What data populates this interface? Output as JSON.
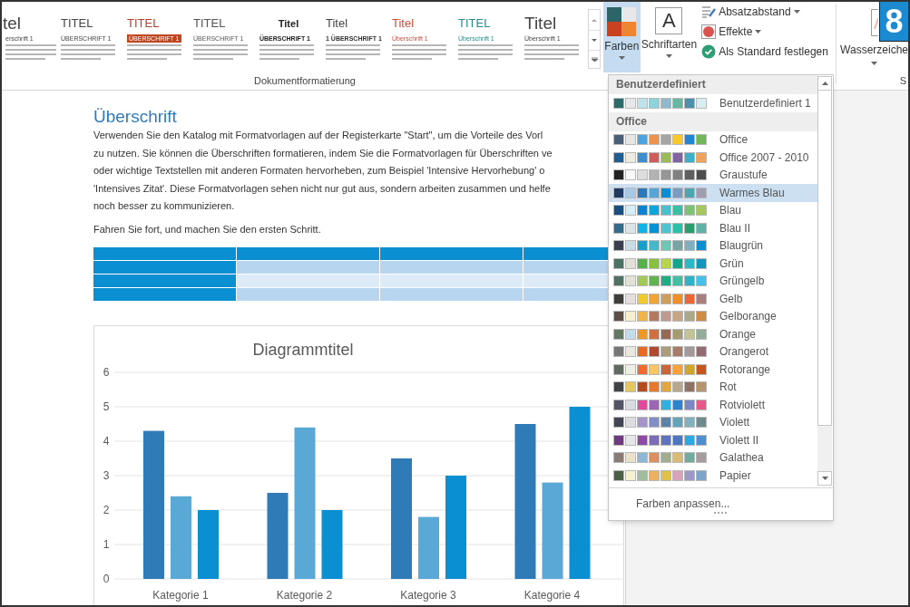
{
  "ribbon": {
    "gallery": [
      {
        "title": {
          "text": "tel",
          "color": "#444444"
        },
        "heading": {
          "text": "erschrift 1"
        },
        "kind": "large"
      },
      {
        "title": {
          "text": "TITEL",
          "color": "#444444"
        },
        "heading": {
          "text": "ÜBERSCHRIFT 1"
        },
        "kind": "plain"
      },
      {
        "title": {
          "text": "TITEL",
          "color": "#c0392b"
        },
        "heading": {
          "text": "ÜBERSCHRIFT 1",
          "color": "#c0461f"
        },
        "kind": "banner"
      },
      {
        "title": {
          "text": "TITEL",
          "color": "#555555"
        },
        "heading": {
          "text": "ÜBERSCHRIFT 1"
        },
        "kind": "plain"
      },
      {
        "title": {
          "text": "Titel",
          "color": "#222222"
        },
        "heading": {
          "text": "ÜBERSCHRIFT 1",
          "color": "#222222"
        },
        "kind": "bold"
      },
      {
        "title": {
          "text": "Titel",
          "color": "#444444"
        },
        "heading": {
          "text": "1 ÜBERSCHRIFT 1",
          "color": "#333333"
        },
        "kind": "bold-heading"
      },
      {
        "title": {
          "text": "Titel",
          "color": "#d04a3a"
        },
        "heading": {
          "text": "Überschrift 1"
        },
        "kind": "plain"
      },
      {
        "title": {
          "text": "TITEL",
          "color": "#2a8a8a"
        },
        "heading": {
          "text": "Überschrift 1"
        },
        "kind": "plain"
      },
      {
        "title": {
          "text": "Titel",
          "color": "#444444"
        },
        "heading": {
          "text": "Überschrift 1"
        },
        "kind": "large"
      }
    ],
    "gallery_label": "Dokumentformatierung",
    "colors_button": {
      "label": "Farben",
      "selected": true
    },
    "fonts_button": {
      "label": "Schriftarten",
      "icon_letter": "A"
    },
    "options": [
      {
        "label": "Absatzabstand",
        "kind": "spacing",
        "dropdown": true
      },
      {
        "label": "Effekte",
        "kind": "effects",
        "dropdown": true
      },
      {
        "label": "Als Standard festlegen",
        "kind": "default",
        "dropdown": false
      }
    ],
    "watermark_label": "Wasserzeiche",
    "next_group_label": "S",
    "badge": "8"
  },
  "document": {
    "heading": "Überschrift",
    "paragraph_lines": [
      "Verwenden Sie den Katalog mit Formatvorlagen auf der Registerkarte \"Start\", um die Vorteile des Vorl",
      "zu nutzen. Sie können die Überschriften formatieren, indem Sie die Formatvorlagen für Überschriften ve",
      "oder wichtige Textstellen mit anderen Formaten hervorheben, zum Beispiel 'Intensive Hervorhebung' o",
      "'Intensives Zitat'. Diese Formatvorlagen sehen nicht nur gut aus, sondern arbeiten zusammen und helfe",
      "noch besser zu kommunizieren."
    ],
    "paragraph2": "Fahren Sie fort, und machen Sie den ersten Schritt.",
    "table_rows": [
      {
        "kind": "header"
      },
      {
        "kind": "band"
      },
      {
        "kind": "plain"
      },
      {
        "kind": "band"
      }
    ],
    "chart_data": {
      "type": "bar",
      "title": "Diagrammtitel",
      "categories": [
        "Kategorie 1",
        "Kategorie 2",
        "Kategorie 3",
        "Kategorie 4"
      ],
      "series": [
        {
          "color": "#2e7bb7",
          "values": [
            4.3,
            2.5,
            3.5,
            4.5
          ]
        },
        {
          "color": "#5aa8d6",
          "values": [
            2.4,
            4.4,
            1.8,
            2.8
          ]
        },
        {
          "color": "#0a8fd3",
          "values": [
            2,
            2,
            3,
            5
          ]
        }
      ],
      "ylim": [
        0,
        6
      ],
      "yticks": [
        0,
        1,
        2,
        3,
        4,
        5,
        6
      ],
      "grid": true
    }
  },
  "colors_menu": {
    "sections": [
      {
        "title": "Benutzerdefiniert",
        "items": [
          {
            "name": "Benutzerdefiniert 1",
            "selected": false,
            "swatches": [
              {
                "color": "#2d6a6a"
              },
              {
                "color": "#e8e8ea"
              },
              {
                "color": "#bfe3ea"
              },
              {
                "color": "#8dd3db"
              },
              {
                "color": "#8fb9cc"
              },
              {
                "color": "#66b8a1"
              },
              {
                "color": "#4e8fab"
              },
              {
                "color": "#d8eef0"
              }
            ]
          }
        ]
      },
      {
        "title": "Office",
        "items": [
          {
            "name": "Office",
            "selected": false,
            "swatches": [
              {
                "color": "#4a6079"
              },
              {
                "color": "#e7e6e6"
              },
              {
                "color": "#4ea3dc"
              },
              {
                "color": "#ed9350"
              },
              {
                "color": "#a5a5a5"
              },
              {
                "color": "#f7c82b"
              },
              {
                "color": "#2386d0"
              },
              {
                "color": "#70b85a"
              }
            ]
          },
          {
            "name": "Office 2007 - 2010",
            "selected": false,
            "swatches": [
              {
                "color": "#1f5e8f"
              },
              {
                "color": "#eeece1"
              },
              {
                "color": "#3e8dcc"
              },
              {
                "color": "#cd5e5b"
              },
              {
                "color": "#9bbb59"
              },
              {
                "color": "#8064a2"
              },
              {
                "color": "#3cb0c8"
              },
              {
                "color": "#f0a45a"
              }
            ]
          },
          {
            "name": "Graustufe",
            "selected": false,
            "swatches": [
              {
                "color": "#222222"
              },
              {
                "color": "#f8f8f8"
              },
              {
                "color": "#dddddd"
              },
              {
                "color": "#b2b2b2"
              },
              {
                "color": "#969696"
              },
              {
                "color": "#808080"
              },
              {
                "color": "#5f5f5f"
              },
              {
                "color": "#4d4d4d"
              }
            ]
          },
          {
            "name": "Warmes Blau",
            "selected": true,
            "swatches": [
              {
                "color": "#1f3b63"
              },
              {
                "color": "#a8c8e8"
              },
              {
                "color": "#2d78b8"
              },
              {
                "color": "#56a5d6"
              },
              {
                "color": "#0b8dd3"
              },
              {
                "color": "#7b9cbf"
              },
              {
                "color": "#4ea6b0"
              },
              {
                "color": "#a09db0"
              }
            ]
          },
          {
            "name": "Blau",
            "selected": false,
            "swatches": [
              {
                "color": "#174f80"
              },
              {
                "color": "#d5edf5"
              },
              {
                "color": "#0d82d0"
              },
              {
                "color": "#0aa6dc"
              },
              {
                "color": "#49c0cb"
              },
              {
                "color": "#3cbea3"
              },
              {
                "color": "#7ec275"
              },
              {
                "color": "#a4c85b"
              }
            ]
          },
          {
            "name": "Blau II",
            "selected": false,
            "swatches": [
              {
                "color": "#366a8a"
              },
              {
                "color": "#dde4e7"
              },
              {
                "color": "#13b2e6"
              },
              {
                "color": "#0993d6"
              },
              {
                "color": "#4ec4d0"
              },
              {
                "color": "#2ebfa8"
              },
              {
                "color": "#2a9e6e"
              },
              {
                "color": "#5fb2a7"
              }
            ]
          },
          {
            "name": "Blaugrün",
            "selected": false,
            "swatches": [
              {
                "color": "#3a3f4f"
              },
              {
                "color": "#c8dbe6"
              },
              {
                "color": "#189fc9"
              },
              {
                "color": "#43b9c9"
              },
              {
                "color": "#6ec6b3"
              },
              {
                "color": "#7aa3a3"
              },
              {
                "color": "#80afc0"
              },
              {
                "color": "#0d8ed3"
              }
            ]
          },
          {
            "name": "Grün",
            "selected": false,
            "swatches": [
              {
                "color": "#4b7262"
              },
              {
                "color": "#e2e0d8"
              },
              {
                "color": "#56b14a"
              },
              {
                "color": "#86c140"
              },
              {
                "color": "#b8d64b"
              },
              {
                "color": "#14a688"
              },
              {
                "color": "#2bb9c6"
              },
              {
                "color": "#1296bd"
              }
            ]
          },
          {
            "name": "Grüngelb",
            "selected": false,
            "swatches": [
              {
                "color": "#4f7264"
              },
              {
                "color": "#e2e3d5"
              },
              {
                "color": "#a1cb56"
              },
              {
                "color": "#61b34e"
              },
              {
                "color": "#1fad84"
              },
              {
                "color": "#45bea6"
              },
              {
                "color": "#30b2c7"
              },
              {
                "color": "#44c2ea"
              }
            ]
          },
          {
            "name": "Gelb",
            "selected": false,
            "swatches": [
              {
                "color": "#403d3d"
              },
              {
                "color": "#e5e0de"
              },
              {
                "color": "#f2cc2e"
              },
              {
                "color": "#f0a534"
              },
              {
                "color": "#cf9e5a"
              },
              {
                "color": "#ef8f2c"
              },
              {
                "color": "#ec6734"
              },
              {
                "color": "#a87e7e"
              }
            ]
          },
          {
            "name": "Gelborange",
            "selected": false,
            "swatches": [
              {
                "color": "#5e4e48"
              },
              {
                "color": "#f8f0cc"
              },
              {
                "color": "#eeb54c"
              },
              {
                "color": "#b57962"
              },
              {
                "color": "#be9b90"
              },
              {
                "color": "#c8a585"
              },
              {
                "color": "#a9a98a"
              },
              {
                "color": "#cd8b44"
              }
            ]
          },
          {
            "name": "Orange",
            "selected": false,
            "swatches": [
              {
                "color": "#637863"
              },
              {
                "color": "#c5dced"
              },
              {
                "color": "#eb9a2a"
              },
              {
                "color": "#cf7040"
              },
              {
                "color": "#966a54"
              },
              {
                "color": "#a59b73"
              },
              {
                "color": "#c2c496"
              },
              {
                "color": "#94ad96"
              }
            ]
          },
          {
            "name": "Orangerot",
            "selected": false,
            "swatches": [
              {
                "color": "#777777"
              },
              {
                "color": "#ebe8e0"
              },
              {
                "color": "#e56a25"
              },
              {
                "color": "#b14b2f"
              },
              {
                "color": "#aa9c7c"
              },
              {
                "color": "#a77b6a"
              },
              {
                "color": "#a39998"
              },
              {
                "color": "#926c70"
              }
            ]
          },
          {
            "name": "Rotorange",
            "selected": false,
            "swatches": [
              {
                "color": "#616a61"
              },
              {
                "color": "#f0efe6"
              },
              {
                "color": "#ee6b33"
              },
              {
                "color": "#f9c667"
              },
              {
                "color": "#c9663a"
              },
              {
                "color": "#f8a23c"
              },
              {
                "color": "#cfa72c"
              },
              {
                "color": "#c5561c"
              }
            ]
          },
          {
            "name": "Rot",
            "selected": false,
            "swatches": [
              {
                "color": "#404246"
              },
              {
                "color": "#e6c75b"
              },
              {
                "color": "#b54b1d"
              },
              {
                "color": "#e5782b"
              },
              {
                "color": "#e3a742"
              },
              {
                "color": "#b8a78c"
              },
              {
                "color": "#8e7365"
              },
              {
                "color": "#b6956c"
              }
            ]
          },
          {
            "name": "Rotviolett",
            "selected": false,
            "swatches": [
              {
                "color": "#525565"
              },
              {
                "color": "#d8dbe1"
              },
              {
                "color": "#de4a9c"
              },
              {
                "color": "#9c66b6"
              },
              {
                "color": "#31aee2"
              },
              {
                "color": "#2f82cc"
              },
              {
                "color": "#7b86c4"
              },
              {
                "color": "#e2598a"
              }
            ]
          },
          {
            "name": "Violett",
            "selected": false,
            "swatches": [
              {
                "color": "#434555"
              },
              {
                "color": "#dddcdf"
              },
              {
                "color": "#a594c9"
              },
              {
                "color": "#818fc6"
              },
              {
                "color": "#5d83a8"
              },
              {
                "color": "#64a3ba"
              },
              {
                "color": "#80b1bd"
              },
              {
                "color": "#6f8b8e"
              }
            ]
          },
          {
            "name": "Violett II",
            "selected": false,
            "swatches": [
              {
                "color": "#6e3b7e"
              },
              {
                "color": "#e7e6eb"
              },
              {
                "color": "#8c4aa4"
              },
              {
                "color": "#7b6cb5"
              },
              {
                "color": "#5e72bf"
              },
              {
                "color": "#4c76c0"
              },
              {
                "color": "#2da9e2"
              },
              {
                "color": "#4d8fd0"
              }
            ]
          },
          {
            "name": "Galathea",
            "selected": false,
            "swatches": [
              {
                "color": "#8b7b75"
              },
              {
                "color": "#ebe2cc"
              },
              {
                "color": "#8db7d6"
              },
              {
                "color": "#dd8f60"
              },
              {
                "color": "#a3ae8e"
              },
              {
                "color": "#d8bc76"
              },
              {
                "color": "#73ab9f"
              },
              {
                "color": "#a59c9f"
              }
            ]
          },
          {
            "name": "Papier",
            "selected": false,
            "swatches": [
              {
                "color": "#4c5f47"
              },
              {
                "color": "#f4f2d0"
              },
              {
                "color": "#a1bba1"
              },
              {
                "color": "#edb060"
              },
              {
                "color": "#dfc048"
              },
              {
                "color": "#d8a2ba"
              },
              {
                "color": "#9c97c5"
              },
              {
                "color": "#7ba6ca"
              }
            ]
          }
        ]
      }
    ],
    "footer": "Farben anpassen..."
  }
}
